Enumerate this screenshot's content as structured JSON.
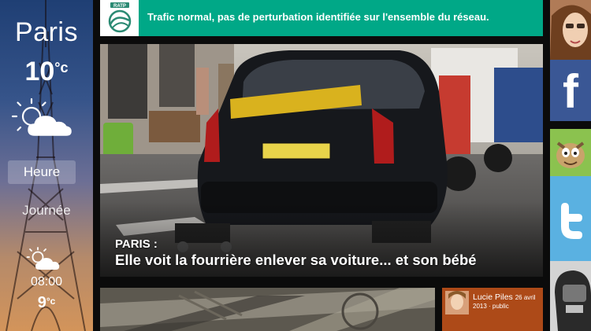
{
  "weather": {
    "city": "Paris",
    "temperature": "10",
    "unit": "°c",
    "current_icon": "sun-cloud-icon",
    "modes": {
      "hour_label": "Heure",
      "day_label": "Journée"
    },
    "forecast": {
      "time": "08:00",
      "temperature": "9",
      "unit": "°c",
      "icon": "sun-cloud-icon"
    }
  },
  "banner": {
    "logo_text": "RATP",
    "message": "Trafic normal, pas de perturbation identifiée sur l'ensemble du réseau.",
    "color": "#00a887"
  },
  "article": {
    "kicker": "PARIS :",
    "title": "Elle voit la fourrière enlever sa voiture... et son bébé"
  },
  "post": {
    "author": "Lucie Piles",
    "date": "26 avril",
    "meta": "2013 · public",
    "color": "#ad4a18"
  },
  "social": {
    "facebook_letter": "f",
    "facebook_color": "#3a5795",
    "twitter_color": "#5ab1e1",
    "items": [
      "profile-photo",
      "facebook-icon",
      "game-tile",
      "twitter-icon",
      "music-tile"
    ]
  }
}
